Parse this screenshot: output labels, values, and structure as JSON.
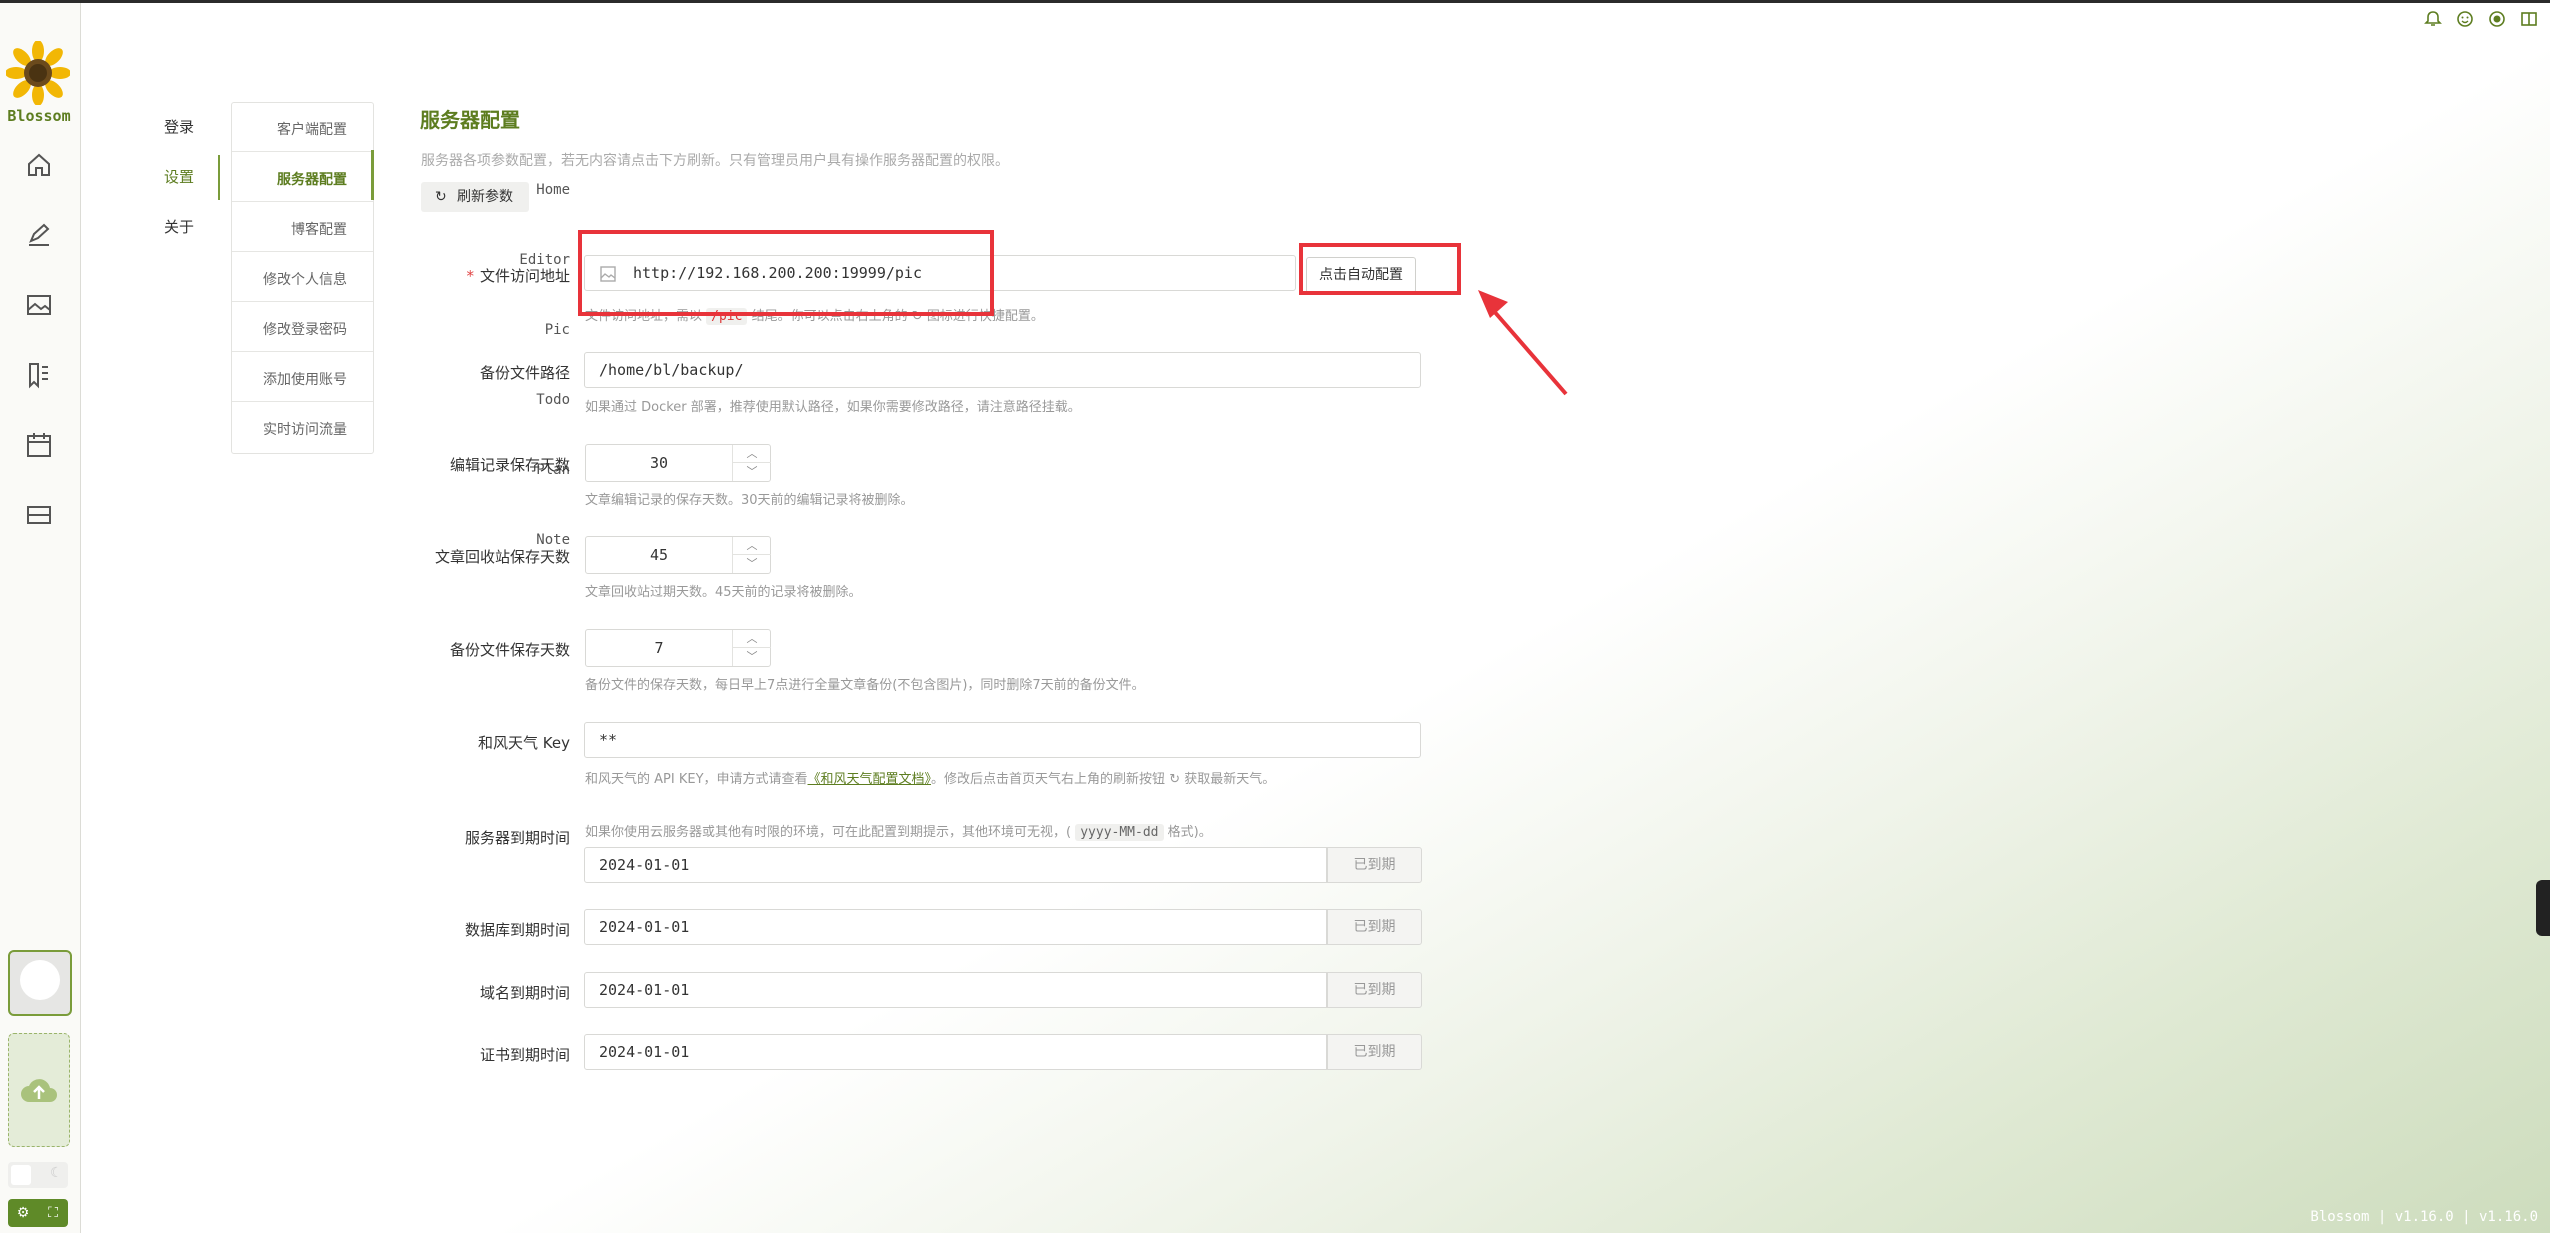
{
  "app": {
    "brand": "Blossom",
    "footer": "Blossom | v1.16.0 | v1.16.0"
  },
  "colors": {
    "accent": "#5d7d20",
    "annotation": "#e8333a"
  },
  "top_icons": [
    "bell-icon",
    "smile-icon",
    "record-icon",
    "book-icon"
  ],
  "rail": {
    "items": [
      {
        "label": "Home",
        "icon": "home-icon"
      },
      {
        "label": "Editor",
        "icon": "editor-icon"
      },
      {
        "label": "Pic",
        "icon": "picture-icon"
      },
      {
        "label": "Todo",
        "icon": "todo-icon"
      },
      {
        "label": "Plan",
        "icon": "calendar-icon"
      },
      {
        "label": "Note",
        "icon": "note-icon"
      }
    ]
  },
  "menu1": {
    "items": [
      "登录",
      "设置",
      "关于"
    ],
    "active": "设置"
  },
  "menu2": {
    "items": [
      "客户端配置",
      "服务器配置",
      "博客配置",
      "修改个人信息",
      "修改登录密码",
      "添加使用账号",
      "实时访问流量"
    ],
    "active": "服务器配置"
  },
  "page": {
    "title": "服务器配置",
    "description": "服务器各项参数配置，若无内容请点击下方刷新。只有管理员用户具有操作服务器配置的权限。",
    "refresh_label": "刷新参数"
  },
  "form": {
    "file_url": {
      "label": "文件访问地址",
      "value": "http://192.168.200.200:19999/pic",
      "button": "点击自动配置",
      "hint_a": "文件访问地址，需以",
      "hint_code": "/pic",
      "hint_b": "结尾。你可以点击右上角的",
      "hint_c": "图标进行快捷配置。"
    },
    "backup_path": {
      "label": "备份文件路径",
      "value": "/home/bl/backup/",
      "hint": "如果通过 Docker 部署，推荐使用默认路径，如果你需要修改路径，请注意路径挂载。"
    },
    "edit_days": {
      "label": "编辑记录保存天数",
      "value": "30",
      "hint": "文章编辑记录的保存天数。30天前的编辑记录将被删除。"
    },
    "recycle_days": {
      "label": "文章回收站保存天数",
      "value": "45",
      "hint": "文章回收站过期天数。45天前的记录将被删除。"
    },
    "backup_days": {
      "label": "备份文件保存天数",
      "value": "7",
      "hint": "备份文件的保存天数，每日早上7点进行全量文章备份(不包含图片)，同时删除7天前的备份文件。"
    },
    "weather_key": {
      "label": "和风天气 Key",
      "value": "**",
      "hint_a": "和风天气的 API KEY，申请方式请查看",
      "hint_link": "《和风天气配置文档》",
      "hint_b": "。修改后点击首页天气右上角的刷新按钮",
      "hint_c": "获取最新天气。"
    },
    "server_expire": {
      "label": "服务器到期时间",
      "hint_a": "如果你使用云服务器或其他有时限的环境，可在此配置到期提示，其他环境可无视，(",
      "hint_code": "yyyy-MM-dd",
      "hint_b": "格式)。",
      "value": "2024-01-01",
      "status": "已到期"
    },
    "db_expire": {
      "label": "数据库到期时间",
      "value": "2024-01-01",
      "status": "已到期"
    },
    "domain_expire": {
      "label": "域名到期时间",
      "value": "2024-01-01",
      "status": "已到期"
    },
    "cert_expire": {
      "label": "证书到期时间",
      "value": "2024-01-01",
      "status": "已到期"
    }
  }
}
